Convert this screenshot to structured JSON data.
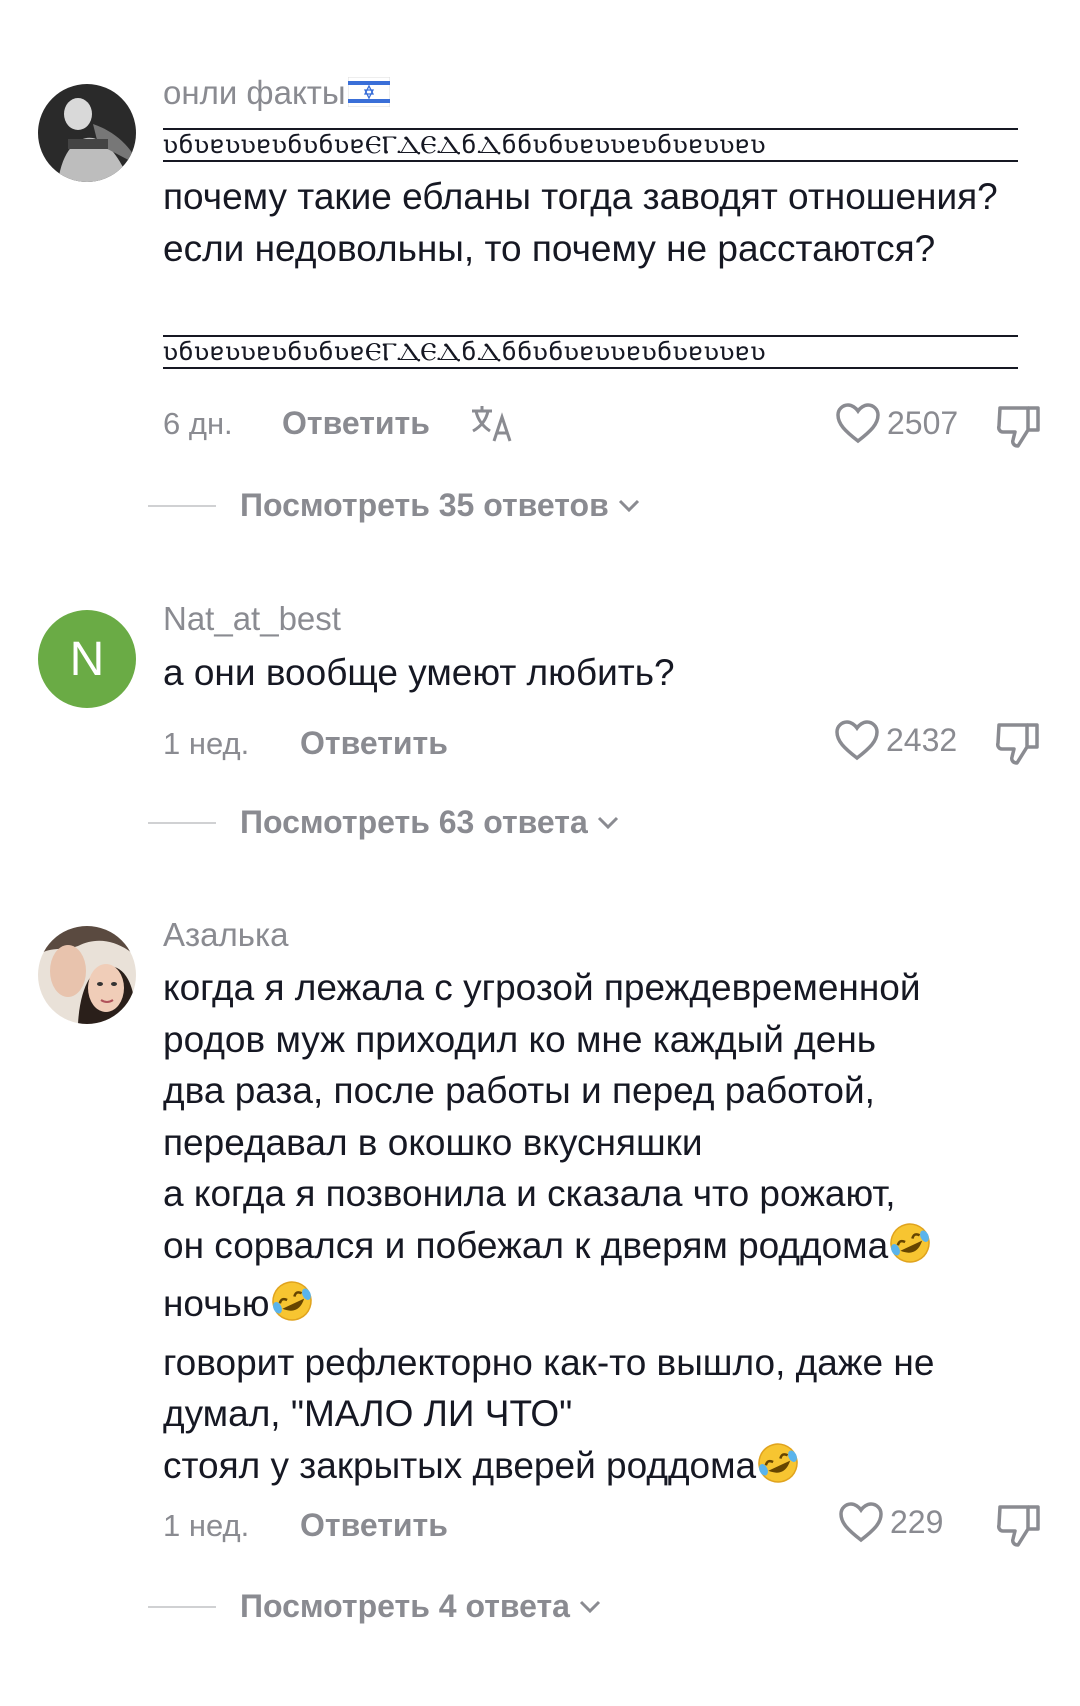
{
  "comments": [
    {
      "username": "онли факты",
      "flag": "israel-flag-icon",
      "deco": "ʋбʋɐʋʋɐʋбʋбʋɐⲈⲄⲆⲈⲆбⲆббʋбʋɐʋʋɐʋбʋɐʋʋɐʋ",
      "text": "почему такие ебланы тогда заводят отношения? если недовольны, то почему не расстаются?",
      "time": "6 дн.",
      "reply": "Ответить",
      "likes": "2507",
      "view_replies": "Посмотреть 35 ответов"
    },
    {
      "username": "Nat_at_best",
      "avatar_letter": "N",
      "text": "а они вообще умеют любить?",
      "time": "1 нед.",
      "reply": "Ответить",
      "likes": "2432",
      "view_replies": "Посмотреть 63 ответа"
    },
    {
      "username": "Азалька",
      "text_lines": [
        "когда я лежала с угрозой преждевременной",
        "родов муж приходил ко мне каждый день",
        "два раза, после работы и перед работой,",
        "передавал в окошко вкусняшки",
        "а когда я позвонила и сказала что рожают,",
        "он сорвался и побежал к дверям роддома",
        "ночью",
        "говорит рефлекторно как-то вышло, даже не",
        "думал, \"МАЛО ЛИ ЧТО\"",
        "стоял у закрытых дверей роддома"
      ],
      "time": "1 нед.",
      "reply": "Ответить",
      "likes": "229",
      "view_replies": "Посмотреть 4 ответа"
    }
  ],
  "icons": {
    "heart": "heart-outline-icon",
    "dislike": "thumbs-down-icon",
    "translate": "translate-icon",
    "chevron": "chevron-down-icon",
    "emoji": "rolling-on-floor-laughing-emoji"
  },
  "colors": {
    "muted": "#8a8b91",
    "text": "#161823",
    "avatar_green": "#6aab45"
  }
}
